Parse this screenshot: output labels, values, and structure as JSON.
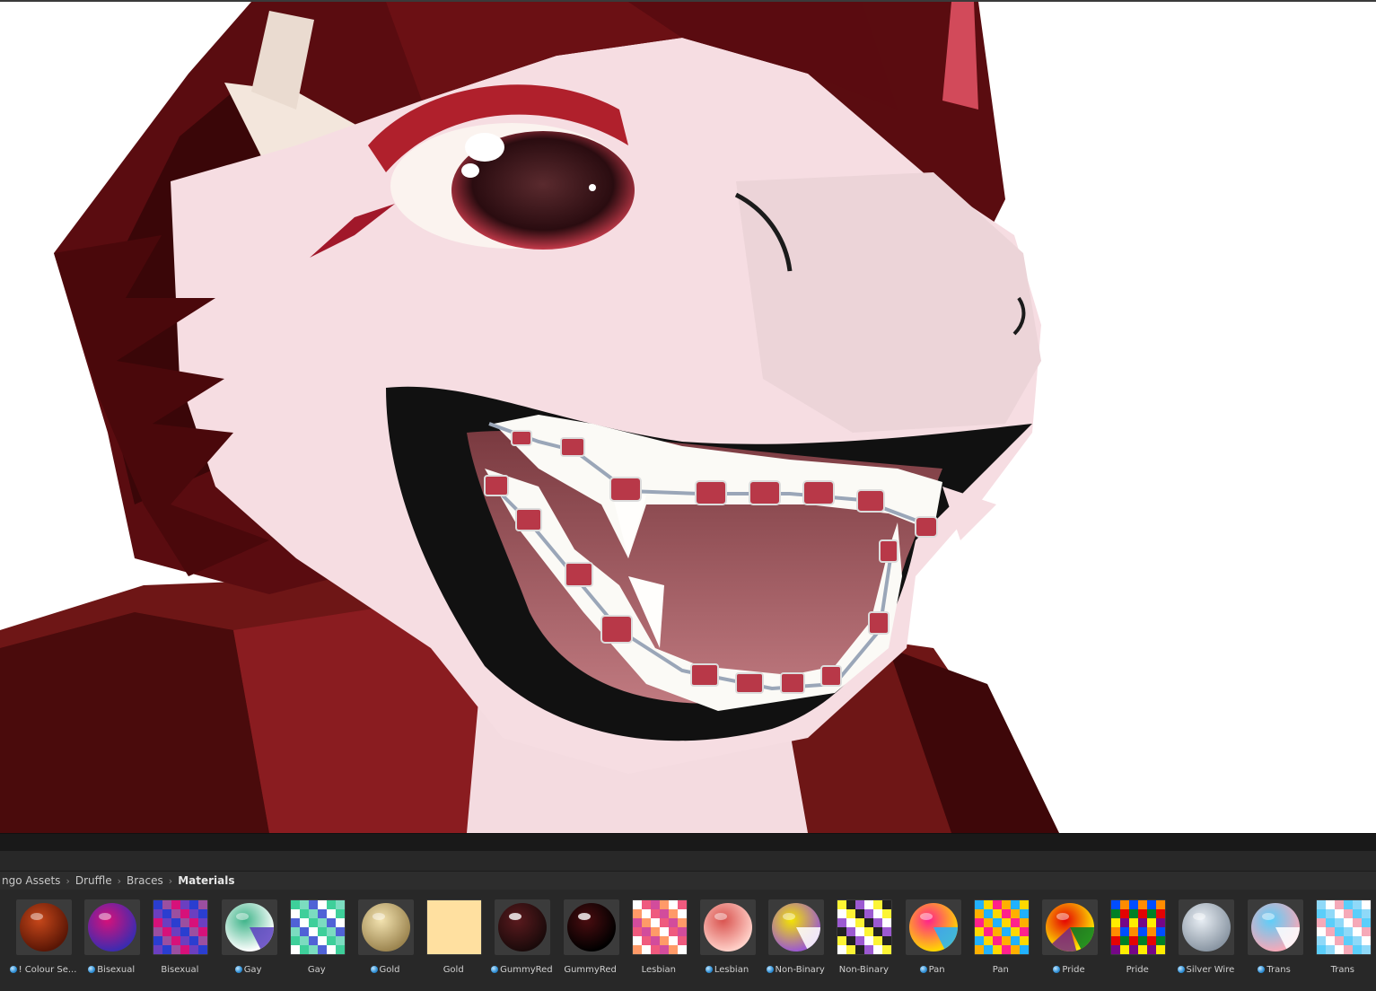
{
  "breadcrumb": [
    "ngo Assets",
    "Druffle",
    "Braces",
    "Materials"
  ],
  "materials": [
    {
      "label": "! Colour Se...",
      "prefab": true,
      "kind": "sphere",
      "colors": [
        "#c7471a",
        "#5a1605"
      ]
    },
    {
      "label": "Bisexual",
      "prefab": true,
      "kind": "sphere",
      "colors": [
        "#d6117a",
        "#3c2bb0"
      ]
    },
    {
      "label": "Bisexual",
      "prefab": false,
      "kind": "texture",
      "colors": [
        "#d6117a",
        "#9b4fa0",
        "#2a3ed0",
        "#6b3fc0"
      ]
    },
    {
      "label": "Gay",
      "prefab": true,
      "kind": "sphere",
      "colors": [
        "#3eb489",
        "#ffffff",
        "#5a3fc0"
      ]
    },
    {
      "label": "Gay",
      "prefab": false,
      "kind": "texture",
      "colors": [
        "#3ecf9a",
        "#ffffff",
        "#5062d6",
        "#7bdcc0"
      ]
    },
    {
      "label": "Gold",
      "prefab": true,
      "kind": "sphere",
      "colors": [
        "#f3e3b0",
        "#9c8550"
      ]
    },
    {
      "label": "Gold",
      "prefab": false,
      "kind": "flat",
      "colors": [
        "#ffe0a0"
      ]
    },
    {
      "label": "GummyRed",
      "prefab": true,
      "kind": "glass",
      "colors": [
        "#5a1a1e",
        "#1a0a0a"
      ]
    },
    {
      "label": "GummyRed",
      "prefab": false,
      "kind": "glass",
      "colors": [
        "#4a0d10",
        "#000000"
      ]
    },
    {
      "label": "Lesbian",
      "prefab": false,
      "kind": "texture",
      "colors": [
        "#ef5a7e",
        "#ffffff",
        "#ff9a68",
        "#d24c9c"
      ]
    },
    {
      "label": "Lesbian",
      "prefab": true,
      "kind": "sphere",
      "colors": [
        "#d9534f",
        "#ffd0c8"
      ]
    },
    {
      "label": "Non-Binary",
      "prefab": true,
      "kind": "sphere",
      "colors": [
        "#f4e400",
        "#9b59d0",
        "#ffffff"
      ]
    },
    {
      "label": "Non-Binary",
      "prefab": false,
      "kind": "texture",
      "colors": [
        "#fcf434",
        "#ffffff",
        "#9c59d1",
        "#222222"
      ]
    },
    {
      "label": "Pan",
      "prefab": true,
      "kind": "sphere",
      "colors": [
        "#ff218c",
        "#ffd800",
        "#21b1ff"
      ]
    },
    {
      "label": "Pan",
      "prefab": false,
      "kind": "texture",
      "colors": [
        "#ff218c",
        "#ffd800",
        "#21b1ff",
        "#ffb000"
      ]
    },
    {
      "label": "Pride",
      "prefab": true,
      "kind": "sphere",
      "colors": [
        "#e40303",
        "#ffed00",
        "#008026",
        "#732982"
      ]
    },
    {
      "label": "Pride",
      "prefab": false,
      "kind": "texture",
      "colors": [
        "#e40303",
        "#ff8c00",
        "#ffed00",
        "#008026",
        "#004dff",
        "#750787"
      ]
    },
    {
      "label": "Silver Wire",
      "prefab": true,
      "kind": "sphere",
      "colors": [
        "#e8eef4",
        "#8a96a3"
      ]
    },
    {
      "label": "Trans",
      "prefab": true,
      "kind": "sphere",
      "colors": [
        "#5bcefa",
        "#f5a9b8",
        "#ffffff"
      ]
    },
    {
      "label": "Trans",
      "prefab": false,
      "kind": "texture",
      "colors": [
        "#5bcefa",
        "#f5a9b8",
        "#ffffff",
        "#8fd9f8"
      ]
    }
  ]
}
